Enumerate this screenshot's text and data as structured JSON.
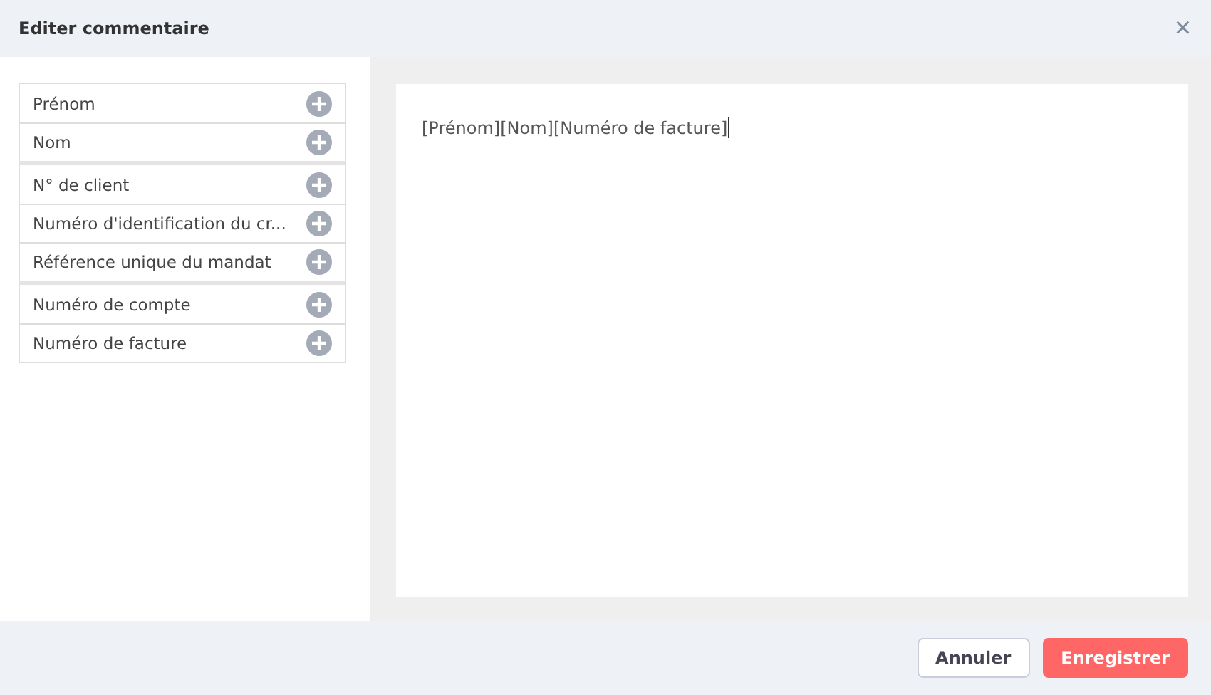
{
  "dialog": {
    "title": "Editer commentaire",
    "close": "×"
  },
  "field_groups": [
    {
      "fields": [
        "Prénom",
        "Nom"
      ]
    },
    {
      "fields": [
        "N° de client",
        "Numéro d'identification du cr...",
        "Référence unique du mandat"
      ]
    },
    {
      "fields": [
        "Numéro de compte",
        "Numéro de facture"
      ]
    }
  ],
  "editor": {
    "value": "[Prénom][Nom][Numéro de facture]"
  },
  "buttons": [
    {
      "label": "Annuler",
      "kind": "secondary"
    },
    {
      "label": "Enregistrer",
      "kind": "primary"
    }
  ]
}
